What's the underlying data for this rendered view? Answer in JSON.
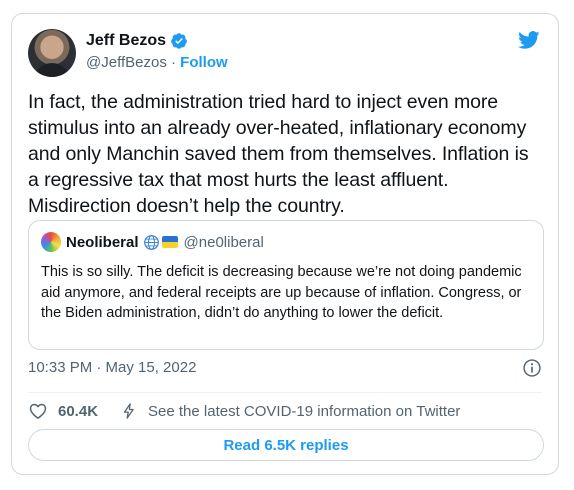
{
  "author": {
    "name": "Jeff Bezos",
    "handle": "@JeffBezos",
    "separator": " · ",
    "follow_label": "Follow"
  },
  "tweet": {
    "text": "In fact, the administration tried hard to inject even more stimulus into an already over-heated, inflationary economy and only Manchin saved them from themselves. Inflation is a regressive tax that most hurts the least affluent. Misdirection doesn’t help the country.",
    "timestamp": "10:33 PM · May 15, 2022"
  },
  "quoted_tweet": {
    "name": "Neoliberal",
    "handle": "@ne0liberal",
    "text": "This is so silly. The deficit is decreasing because we’re not doing pandemic aid anymore, and federal receipts are up because of inflation. Congress, or the Biden administration, didn’t do anything to lower the deficit."
  },
  "actions": {
    "likes": "60.4K",
    "covid_info": "See the latest COVID-19 information on Twitter",
    "read_replies": "Read 6.5K replies"
  },
  "colors": {
    "accent": "#1d9bf0",
    "text_primary": "#0f1419",
    "text_secondary": "#536471",
    "border": "#cfd9de"
  },
  "icons": [
    "verified-badge-icon",
    "twitter-bird-icon",
    "globe-icon",
    "ukraine-flag-icon",
    "info-icon",
    "heart-icon",
    "lightning-icon"
  ]
}
